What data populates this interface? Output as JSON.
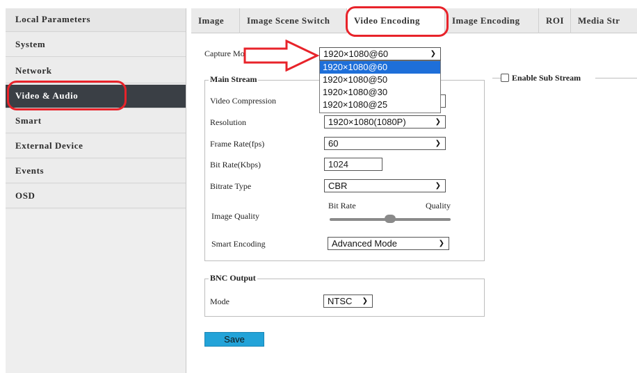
{
  "sidebar": {
    "header": "Local Parameters",
    "items": [
      "System",
      "Network",
      "Video & Audio",
      "Smart",
      "External Device",
      "Events",
      "OSD"
    ],
    "active": "Video & Audio"
  },
  "tabs": [
    "Image",
    "Image Scene Switch",
    "Video Encoding",
    "Image Encoding",
    "ROI",
    "Media Str"
  ],
  "active_tab": "Video Encoding",
  "capture_mode": {
    "label": "Capture Mode",
    "value": "1920×1080@60",
    "options": [
      "1920×1080@60",
      "1920×1080@50",
      "1920×1080@30",
      "1920×1080@25"
    ],
    "highlighted": "1920×1080@60"
  },
  "main_stream": {
    "legend": "Main Stream",
    "video_compression": {
      "label": "Video Compression",
      "value": ""
    },
    "resolution": {
      "label": "Resolution",
      "value": "1920×1080(1080P)"
    },
    "frame_rate": {
      "label": "Frame Rate(fps)",
      "value": "60"
    },
    "bit_rate": {
      "label": "Bit Rate(Kbps)",
      "value": "1024"
    },
    "bitrate_type": {
      "label": "Bitrate Type",
      "value": "CBR"
    },
    "image_quality": {
      "label": "Image Quality",
      "left_label": "Bit Rate",
      "right_label": "Quality",
      "level": 0.5
    },
    "smart_encoding": {
      "label": "Smart Encoding",
      "value": "Advanced Mode"
    }
  },
  "sub_stream": {
    "label": "Enable Sub Stream",
    "checked": false
  },
  "bnc_output": {
    "legend": "BNC Output",
    "mode": {
      "label": "Mode",
      "value": "NTSC"
    }
  },
  "save_label": "Save",
  "icons": {
    "dropdown": "chevron-down-icon",
    "annotation_arrow": "red-arrow-icon"
  },
  "colors": {
    "active_nav": "#3a3f45",
    "save_button": "#23a3d8",
    "highlight_option": "#1e6fd9",
    "annotation": "#e8232a"
  }
}
